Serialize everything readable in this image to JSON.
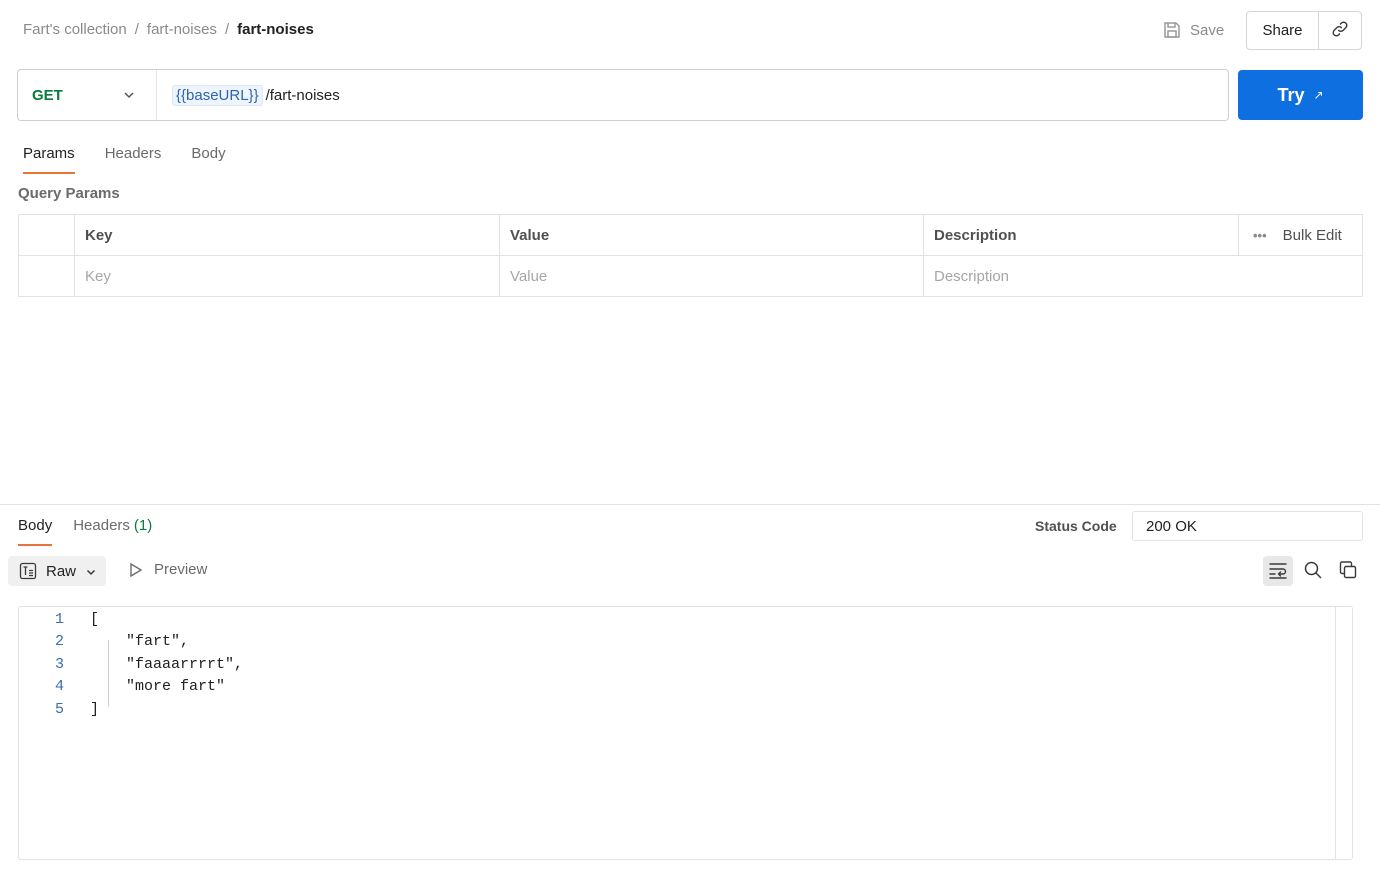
{
  "breadcrumb": {
    "collection": "Fart's collection",
    "folder": "fart-noises",
    "current": "fart-noises",
    "separator": "/"
  },
  "header": {
    "save_label": "Save",
    "share_label": "Share",
    "save_icon": "save-icon",
    "link_icon": "link-icon"
  },
  "request": {
    "method": "GET",
    "url_variable": "{{baseURL}}",
    "url_path": "/fart-noises",
    "try_label": "Try",
    "try_arrow": "↗"
  },
  "request_tabs": [
    {
      "label": "Params",
      "active": true
    },
    {
      "label": "Headers",
      "active": false
    },
    {
      "label": "Body",
      "active": false
    }
  ],
  "query_params": {
    "title": "Query Params",
    "columns": {
      "key": "Key",
      "value": "Value",
      "description": "Description"
    },
    "bulk_edit": "Bulk Edit",
    "more_icon": "•••",
    "placeholders": {
      "key": "Key",
      "value": "Value",
      "description": "Description"
    }
  },
  "response": {
    "tabs": [
      {
        "label": "Body",
        "active": true
      },
      {
        "label": "Headers",
        "count": "(1)",
        "active": false
      }
    ],
    "status_label": "Status Code",
    "status_value": "200 OK",
    "format_label": "Raw",
    "preview_label": "Preview",
    "code_lines": [
      {
        "num": "1",
        "text": "["
      },
      {
        "num": "2",
        "text": "    \"fart\","
      },
      {
        "num": "3",
        "text": "    \"faaaarrrrt\","
      },
      {
        "num": "4",
        "text": "    \"more fart\""
      },
      {
        "num": "5",
        "text": "]"
      }
    ]
  },
  "colors": {
    "accent_tab": "#e8743b",
    "try_button": "#0d6fe0",
    "method_get": "#0b7a3e",
    "variable": "#2e64b0"
  }
}
